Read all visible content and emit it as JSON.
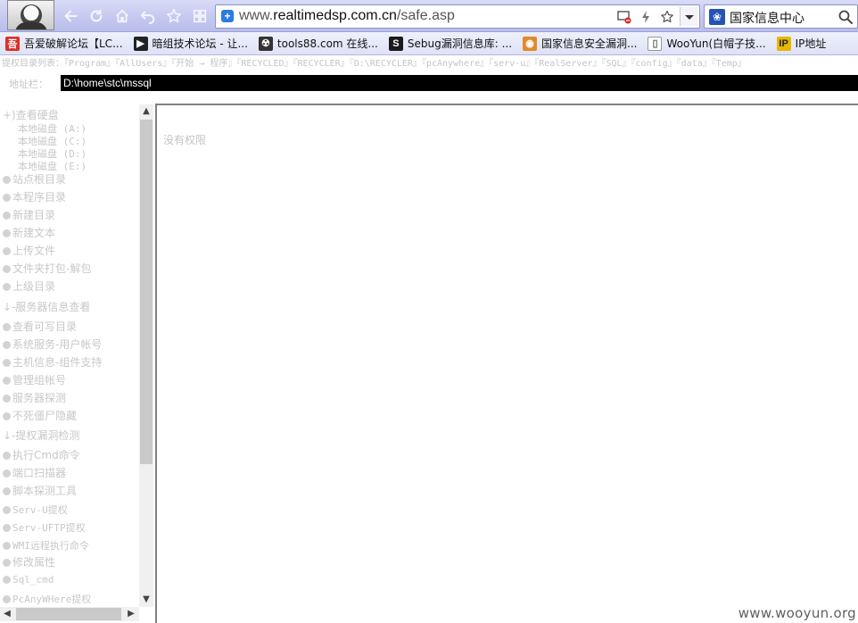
{
  "browser": {
    "url_prefix": "www.",
    "url_domain": "realtimedsp.com.cn",
    "url_path": "/safe.asp",
    "search_text": "国家信息中心",
    "icons": {
      "back": "back-arrow-icon",
      "reload": "reload-icon",
      "home": "home-icon",
      "undo": "undo-icon",
      "favorite": "star-icon",
      "apps": "grid-icon"
    }
  },
  "bookmarks": [
    {
      "label": "吾爱破解论坛【LC...",
      "icon": "吾",
      "color": "#d9302a"
    },
    {
      "label": "暗组技术论坛 - 让...",
      "icon": "▶",
      "color": "#222222"
    },
    {
      "label": "tools88.com 在线...",
      "icon": "☢",
      "color": "#333333"
    },
    {
      "label": "Sebug漏洞信息库: ...",
      "icon": "S",
      "color": "#1a1a1a"
    },
    {
      "label": "国家信息安全漏洞...",
      "icon": "◉",
      "color": "#e08a2c"
    },
    {
      "label": "WooYun(白帽子技...",
      "icon": "▯",
      "color": "#ffffff"
    },
    {
      "label": "IP地址",
      "icon": "IP",
      "color": "#e6b800"
    }
  ],
  "page": {
    "quick_links": "提权目录列表：『Program』『AllUsers』『开始 → 程序』『RECYCLED』『RECYCLER』『D:\\RECYCLER』『pcAnywhere』『serv-u』『RealServer』『SQL』『config』『data』『Temp』",
    "address_label": "地址栏：",
    "address_value": "D:\\home\\stc\\mssql",
    "content_message": "没有权限",
    "watermark": "www.wooyun.org"
  },
  "sidebar": {
    "drives_header": "+)查看硬盘",
    "drives": [
      "本地磁盘 (A:)",
      "本地磁盘 (C:)",
      "本地磁盘 (D:)",
      "本地磁盘 (E:)"
    ],
    "file_items": [
      "站点根目录",
      "本程序目录",
      "新建目录",
      "新建文本",
      "上传文件",
      "文件夹打包-解包",
      "上级目录"
    ],
    "server_header": "↓-服务器信息查看",
    "server_items": [
      "查看可写目录",
      "系统服务-用户帐号",
      "主机信息-组件支持",
      "管理组帐号",
      "服务器探测",
      "不死僵尸隐藏"
    ],
    "exploit_header": "↓-提权漏洞检测",
    "exploit_items": [
      "执行Cmd命令",
      "端口扫描器",
      "脚本探测工具",
      "Serv-U提权",
      "Serv-UFTP提权",
      "WMI远程执行命令",
      "修改属性",
      "Sql_cmd",
      "PcAnyWHere提权"
    ]
  }
}
